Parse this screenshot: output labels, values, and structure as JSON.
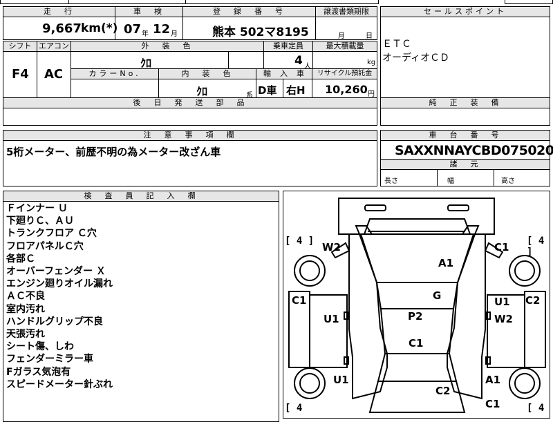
{
  "top_row": {
    "mileage_header": "走　行",
    "mileage_value": "9,667",
    "mileage_unit": "km(*)",
    "inspection_header": "車　検",
    "inspection_year": "07",
    "inspection_year_unit": "年",
    "inspection_month": "12",
    "inspection_month_unit": "月",
    "registration_header": "登　録　番　号",
    "registration_value": "熊本 502マ8195",
    "transfer_header": "譲渡書類期限",
    "transfer_month_unit": "月",
    "transfer_day_unit": "日"
  },
  "row2": {
    "shift_header": "シフト",
    "shift_value": "F4",
    "ac_header": "エアコン",
    "ac_value": "AC",
    "exterior_color_header": "外　装　色",
    "exterior_color_value": "ｸﾛ",
    "capacity_header": "乗車定員",
    "capacity_value": "4",
    "capacity_unit": "人",
    "load_header": "最大積載量",
    "load_unit": "kg",
    "color_no_header": "カラーNo.",
    "interior_color_header": "内　装　色",
    "interior_color_value": "ｸﾛ",
    "interior_color_suffix": "系",
    "import_header": "輸　入　車",
    "import_value_1": "D車",
    "import_value_2": "右H",
    "recycle_header": "リサイクル預託金",
    "recycle_value": "10,260",
    "recycle_unit": "円"
  },
  "sales_point": {
    "header": "セールスポイント",
    "items": [
      "ＥＴＣ",
      "オーディオＣＤ"
    ]
  },
  "later_parts": {
    "header": "後　日　発　送　部　品"
  },
  "genuine_equipment": {
    "header": "純　正　装　備"
  },
  "notes": {
    "header": "注　意　事　項　欄",
    "text": "5桁メーター、前歴不明の為メーター改ざん車"
  },
  "chassis": {
    "header": "車　台　番　号",
    "value": "SAXXNNAYCBD075020",
    "dims_header": "諸　元",
    "length_label": "長さ",
    "width_label": "幅",
    "height_label": "高さ"
  },
  "inspector": {
    "header": "検　査　員　記　入　欄",
    "lines": [
      "Ｆインナー Ｕ",
      "下廻りＣ、ＡＵ",
      "トランクフロア Ｃ穴",
      "フロアパネルＣ穴",
      "各部Ｃ",
      "オーバーフェンダー Ｘ",
      "エンジン廻りオイル漏れ",
      "ＡＣ不良",
      "室内汚れ",
      "ハンドルグリップ不良",
      "天張汚れ",
      "シート傷、しわ",
      "フェンダーミラー車",
      "Fガラス気泡有",
      "スピードメーター針ぶれ"
    ]
  },
  "diagram": {
    "tire_left_top": "[ 4 ]",
    "tire_right_top": "[ 4 ]",
    "tire_left_bottom": "[ 4",
    "tire_right_bottom": "[ 4",
    "marks": {
      "w2_left": "W2",
      "c1_top_right": "C1",
      "a1_hood": "A1",
      "c1_left": "C1",
      "g_windshield": "G",
      "u1_right": "U1",
      "c2_right": "C2",
      "u1_left_door": "U1",
      "p2_roof": "P2",
      "w2_right_door": "W2",
      "c1_roof_rear": "C1",
      "u1_left_rear": "U1",
      "a1_right_rear": "A1",
      "c2_trunk": "C2",
      "c1_bottom_right": "C1"
    }
  }
}
